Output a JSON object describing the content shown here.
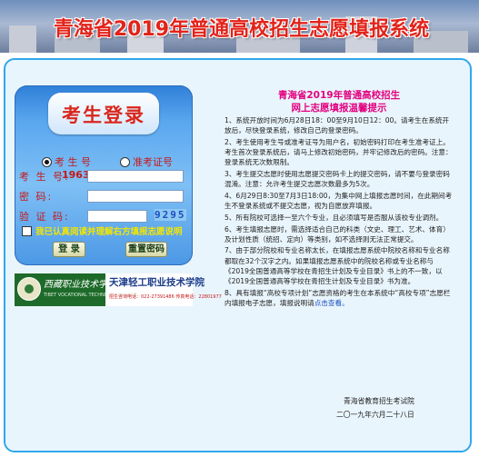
{
  "banner": {
    "title": "青海省2019年普通高校招生志愿填报系统"
  },
  "login": {
    "title": "考生登录",
    "radio_exam_no": "考 生 号",
    "radio_ticket_no": "准考证号",
    "label_exam_no": "考 生 号:",
    "year_prefix": "1963",
    "label_password": "密  码:",
    "label_captcha": "验 证 码:",
    "captcha_value": "9295",
    "agree_text": "我已认真阅读并理解右方填报志愿说明",
    "btn_login": "登 录",
    "btn_reset": "重置密码"
  },
  "partner": {
    "logo_text": "西藏职业技术学院",
    "logo_en": "TIBET VOCATIONAL TECHNICAL COLLEGE",
    "name": "天津轻工职业技术学院",
    "phone": "招生咨询电话：022-27391486 传真电话：22801977"
  },
  "notice": {
    "title_line1": "青海省2019年普通高校招生",
    "title_line2": "网上志愿填报温馨提示",
    "items": [
      "1、系统开放时间为6月28日18：00至9月10日12：00。请考生在系统开放后，尽快登录系统，修改自己的登录密码。",
      "2、考生使用考生号或准考证号为用户名，初始密码打印在考生准考证上。考生首次登录系统后，请马上修改初始密码，并牢记修改后的密码。注意：登录系统无次数限制。",
      "3、考生提交志愿时使用志愿提交密码卡上的提交密码，请不要与登录密码混淆。注意：允许考生提交志愿次数最多为5次。",
      "4、6月29日8:30至7月3日18:00，为集中网上填报志愿时间，在此期间考生不登录系统或不提交志愿，视为自愿放弃填报。",
      "5、所有院校可选择一至六个专业，且必须填写是否服从该校专业调剂。",
      "6、考生填报志愿时，需选择适合自己的科类（文史、理工、艺术、体育）及计划性质（统招、定向）等类别，如不选择则无法正常提交。",
      "7、由于部分院校和专业名称太长，在填报志愿系统中院校名称和专业名称都取在32个汉字之内。如果填报志愿系统中的院校名称或专业名称与《2019全国普通高等学校在青招生计划及专业目录》书上的不一致，以《2019全国普通高等学校在青招生计划及专业目录》书为准。",
      "8、具有填报“高校专项计划”志愿资格的考生在本系统中“高校专项”志愿栏内填报电子志愿，填报说明请"
    ],
    "link_text": "点击查看。",
    "signature_org": "青海省教育招生考试院",
    "signature_date": "二〇一九年六月二十八日"
  },
  "colors": {
    "title_red": "#e2231a",
    "frame_blue": "#2fa8ec",
    "notice_title": "#e4007f",
    "agree_yellow": "#f3e600"
  }
}
